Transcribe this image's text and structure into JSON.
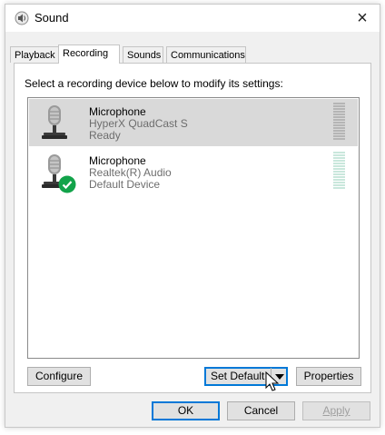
{
  "window": {
    "title": "Sound",
    "close_glyph": "×",
    "icon": "speaker-icon"
  },
  "tabs": [
    {
      "label": "Playback",
      "active": false
    },
    {
      "label": "Recording",
      "active": true
    },
    {
      "label": "Sounds",
      "active": false
    },
    {
      "label": "Communications",
      "active": false
    }
  ],
  "recording": {
    "instruction": "Select a recording device below to modify its settings:",
    "devices": [
      {
        "name": "Microphone",
        "description": "HyperX QuadCast S",
        "status": "Ready",
        "selected": true,
        "default_badge": false
      },
      {
        "name": "Microphone",
        "description": "Realtek(R) Audio",
        "status": "Default Device",
        "selected": false,
        "default_badge": true
      }
    ]
  },
  "buttons": {
    "configure": "Configure",
    "set_default": "Set Default",
    "properties": "Properties",
    "ok": "OK",
    "cancel": "Cancel",
    "apply": "Apply"
  },
  "colors": {
    "selection": "#d9d9d9",
    "meter_idle": "#c9e7dc",
    "meter_idle_selected": "#b5b5b5",
    "default_check": "#12a34a",
    "focus_border": "#0078d7"
  }
}
